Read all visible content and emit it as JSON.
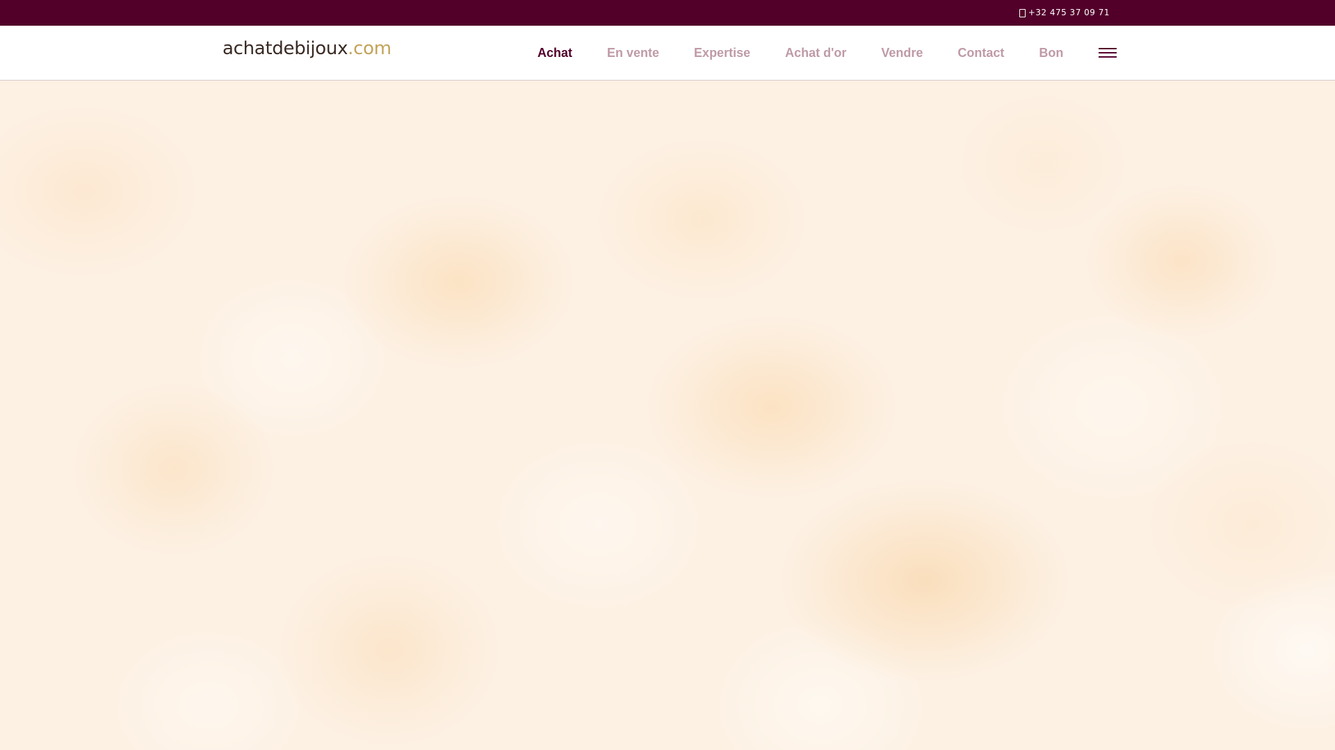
{
  "topbar": {
    "phone_icon": "mobile-phone-icon",
    "phone": "+32 475 37 09 71"
  },
  "header": {
    "logo": {
      "main": "achatdebijoux",
      "tld": ".com"
    },
    "nav": [
      {
        "label": "Achat",
        "active": true
      },
      {
        "label": "En vente",
        "active": false
      },
      {
        "label": "Expertise",
        "active": false
      },
      {
        "label": "Achat d'or",
        "active": false
      },
      {
        "label": "Vendre",
        "active": false
      },
      {
        "label": "Contact",
        "active": false
      },
      {
        "label": "Bon",
        "active": false
      }
    ],
    "menu_icon": "hamburger-menu-icon"
  },
  "colors": {
    "brand": "#52002a",
    "nav_inactive": "#bf9aa8",
    "logo_text": "#3a2a24",
    "logo_accent": "#c3a35a",
    "hero_background": "#fdf1e4"
  }
}
